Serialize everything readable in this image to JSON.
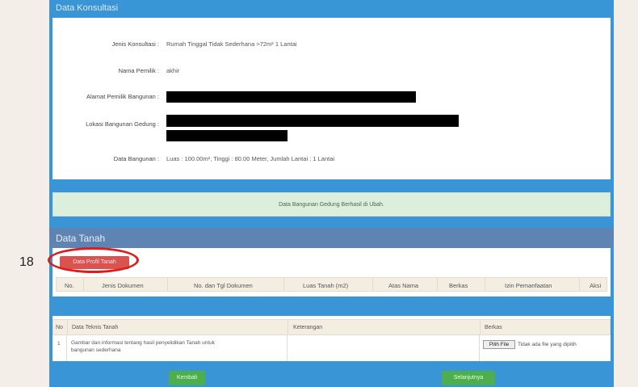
{
  "konsultasi": {
    "header": "Data Konsultasi",
    "jenis_label": "Jenis Konsultasi :",
    "jenis_value": "Rumah Tinggal Tidak Sederhana >72m² 1 Lantai",
    "nama_label": "Nama Pemilik :",
    "nama_value": "akhir",
    "alamat_label": "Alamat Pemilik Bangunan :",
    "lokasi_label": "Lokasi Bangunan Gedung :",
    "data_label": "Data Bangunan :",
    "data_value": "Luas : 100.00m², Tinggi : 80.00 Meter, Jumlah Lantai : 1 Lantai"
  },
  "alert": {
    "message": "Data Bangunan Gedung Berhasil di Ubah."
  },
  "tanah": {
    "header": "Data Tanah",
    "profil_button": "Data Profil Tanah",
    "annotation_number": "18",
    "columns": [
      "No.",
      "Jenis Dokumen",
      "No. dan Tgl Dokumen",
      "Luas Tanah (m2)",
      "Atas Nama",
      "Berkas",
      "Izin Pemanfaatan",
      "Aksi"
    ]
  },
  "teknis": {
    "columns": [
      "No",
      "Data Teknis Tanah",
      "Keterangan",
      "Berkas"
    ],
    "row": {
      "no": "1",
      "desc_line1": "Gambar dan informasi tentang hasil penyelidikan Tanah untuk",
      "desc_line2": "bangunan sederhana",
      "file_button": "Pilih File",
      "file_status": "Tidak ada file yang dipilih"
    }
  },
  "footer": {
    "back_button": "Kembali",
    "next_button": "Selanjutnya"
  },
  "colors": {
    "primary": "#3a95d6",
    "tanah_header": "#5d84b3",
    "danger": "#d9534f",
    "success": "#4cae4c",
    "annotation": "#e01b1b"
  }
}
